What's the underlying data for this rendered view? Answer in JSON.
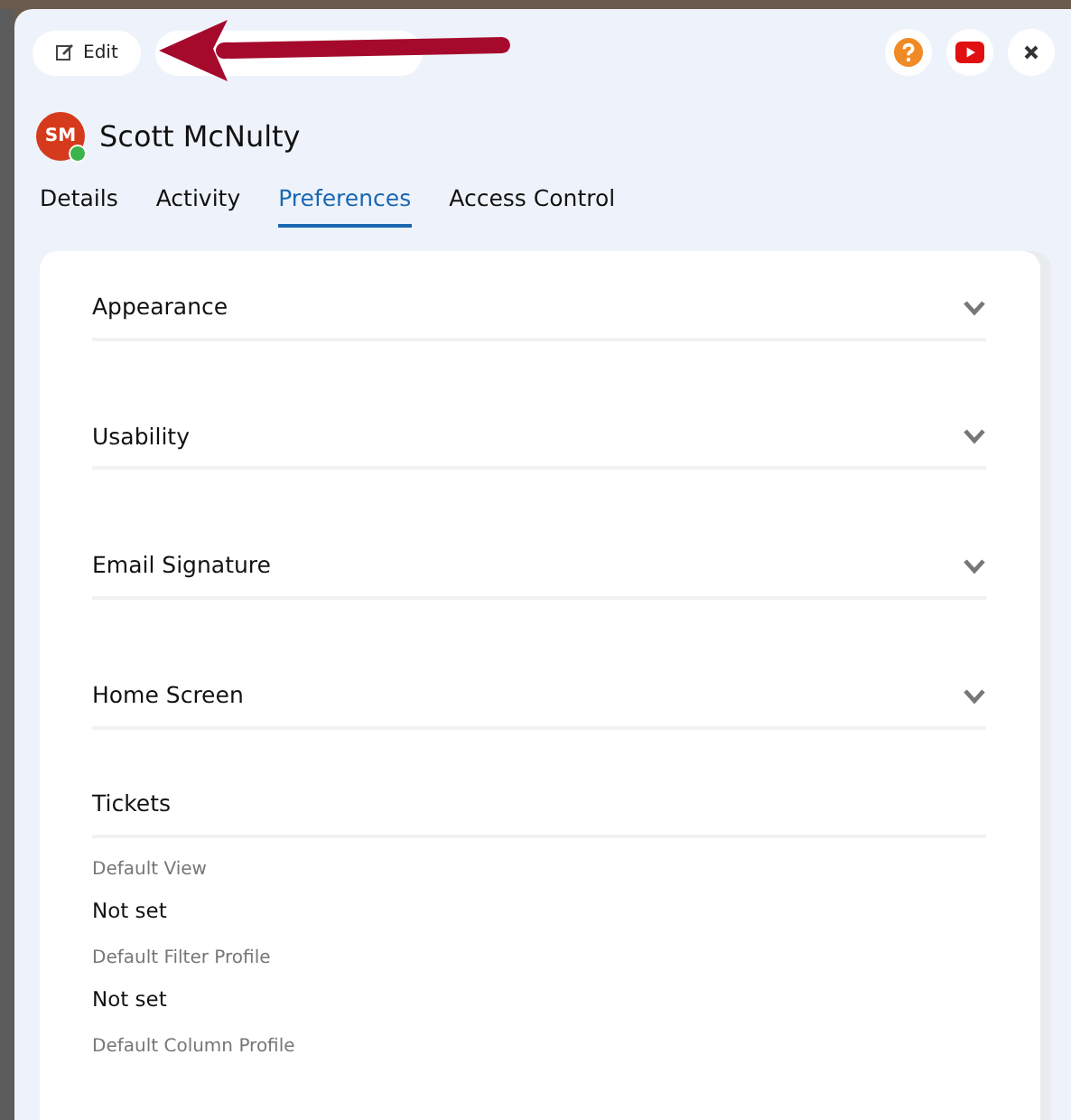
{
  "toolbar": {
    "edit_button": "Edit"
  },
  "user": {
    "initials": "SM",
    "name": "Scott McNulty",
    "online": true
  },
  "tabs": [
    {
      "label": "Details",
      "selected": false
    },
    {
      "label": "Activity",
      "selected": false
    },
    {
      "label": "Preferences",
      "selected": true
    },
    {
      "label": "Access Control",
      "selected": false
    }
  ],
  "sections": [
    {
      "kind": "accordion",
      "title": "Appearance",
      "expanded": false
    },
    {
      "kind": "accordion",
      "title": "Usability",
      "expanded": false
    },
    {
      "kind": "accordion",
      "title": "Email Signature",
      "expanded": false
    },
    {
      "kind": "accordion",
      "title": "Home Screen",
      "expanded": false
    },
    {
      "kind": "fields",
      "title": "Tickets",
      "fields": [
        {
          "label": "Default View",
          "value": "Not set"
        },
        {
          "label": "Default Filter Profile",
          "value": "Not set"
        },
        {
          "label": "Default Column Profile"
        }
      ]
    }
  ]
}
